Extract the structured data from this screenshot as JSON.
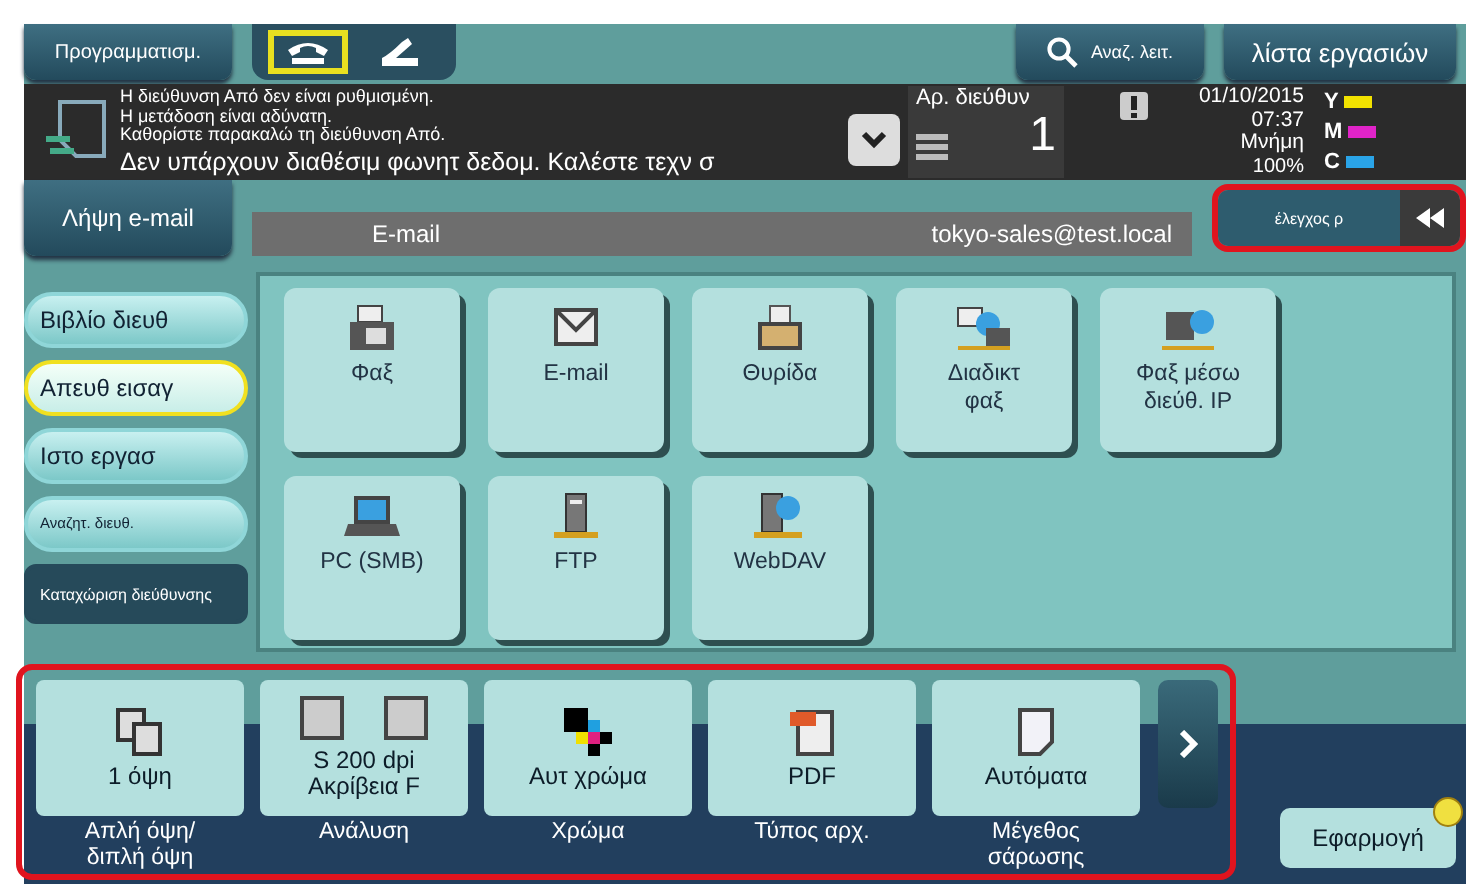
{
  "top_bar": {
    "program_button": "Προγραμματισμ.",
    "line_tabs": [
      {
        "kind": "handset",
        "selected": true
      },
      {
        "kind": "hook",
        "selected": false
      }
    ],
    "search_button": "Αναζ. λειτ.",
    "job_list_button": "λίστα εργασιών"
  },
  "message_panel": {
    "notice_lines": [
      "Η διεύθυνση Από δεν είναι ρυθμισμένη.",
      "Η μετάδοση είναι αδύνατη.",
      "Καθορίστε παρακαλώ τη διεύθυνση Από."
    ],
    "message": "Δεν υπάρχουν διαθέσιμ φωνητ δεδομ. Καλέστε τεχν σ",
    "address_count": {
      "label": "Αρ. διεύθυν",
      "value": "1"
    },
    "date": "01/10/2015",
    "time": "07:37",
    "memory_label": "Μνήμη",
    "memory_value": "100%",
    "toner": [
      {
        "label": "Y",
        "color": "#f2e200"
      },
      {
        "label": "M",
        "color": "#e024c8"
      },
      {
        "label": "C",
        "color": "#2aa4e8"
      }
    ]
  },
  "receive_email_tab": "Λήψη e-mail",
  "destination_bar": {
    "label": "E-mail",
    "value": "tokyo-sales@test.local"
  },
  "check_button": "έλεγχος ρ",
  "sidebar": [
    {
      "label": "Βιβλίο διευθ",
      "kind": "pill",
      "selected": false
    },
    {
      "label": "Απευθ εισαγ",
      "kind": "pill",
      "selected": true
    },
    {
      "label": "Ιστο εργασ",
      "kind": "pill",
      "selected": false
    },
    {
      "label": "Αναζητ. διευθ.",
      "kind": "pill-small",
      "selected": false
    },
    {
      "label": "Καταχώριση διεύθυνσης",
      "kind": "dark",
      "selected": false
    }
  ],
  "destinations": [
    {
      "label": "Φαξ",
      "kind": "fax"
    },
    {
      "label": "E-mail",
      "kind": "envelope"
    },
    {
      "label": "Θυρίδα",
      "kind": "tray"
    },
    {
      "label": "Διαδικτ\nφαξ",
      "kind": "internet-fax"
    },
    {
      "label": "Φαξ μέσω\nδιεύθ. IP",
      "kind": "ip-fax"
    },
    {
      "label": "PC (SMB)",
      "kind": "laptop"
    },
    {
      "label": "FTP",
      "kind": "server"
    },
    {
      "label": "WebDAV",
      "kind": "web-server"
    }
  ],
  "settings": [
    {
      "value": "1 όψη",
      "caption": "Απλή όψη/\nδιπλή όψη",
      "kind": "duplex"
    },
    {
      "value": "S 200 dpi\nΑκρίβεια F",
      "caption": "Ανάλυση",
      "kind": "resolution"
    },
    {
      "value": "Αυτ χρώμα",
      "caption": "Χρώμα",
      "kind": "color"
    },
    {
      "value": "PDF",
      "caption": "Τύπος αρχ.",
      "kind": "pdf"
    },
    {
      "value": "Αυτόματα",
      "caption": "Μέγεθος\nσάρωσης",
      "kind": "page"
    }
  ],
  "apply_button": "Εφαρμογή"
}
